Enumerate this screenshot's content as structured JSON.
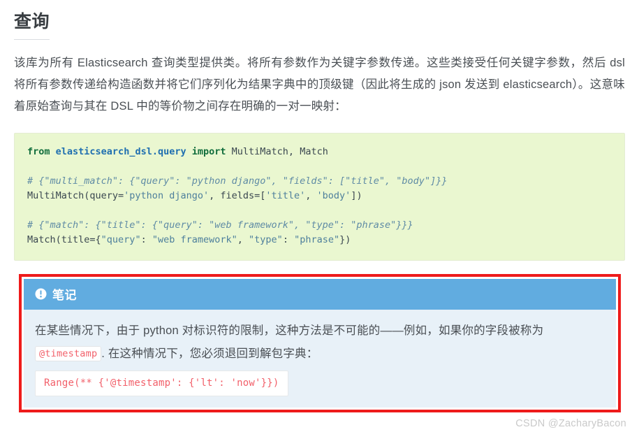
{
  "page": {
    "title": "查询",
    "intro": "该库为所有 Elasticsearch 查询类型提供类。将所有参数作为关键字参数传递。这些类接受任何关键字参数，然后 dsl 将所有参数传递给构造函数并将它们序列化为结果字典中的顶级键（因此将生成的 json 发送到 elasticsearch）。这意味着原始查询与其在 DSL 中的等价物之间存在明确的一对一映射："
  },
  "code_block": {
    "line1_kw_from": "from",
    "line1_module": "elasticsearch_dsl.query",
    "line1_kw_import": "import",
    "line1_names": "MultiMatch, Match",
    "line2_comment": "# {\"multi_match\": {\"query\": \"python django\", \"fields\": [\"title\", \"body\"]}}",
    "line3_call": "MultiMatch(query=",
    "line3_str1": "'python django'",
    "line3_mid": ", fields=[",
    "line3_str2": "'title'",
    "line3_sep": ", ",
    "line3_str3": "'body'",
    "line3_end": "])",
    "line4_comment": "# {\"match\": {\"title\": {\"query\": \"web framework\", \"type\": \"phrase\"}}}",
    "line5_call": "Match(title={",
    "line5_str1": "\"query\"",
    "line5_mid1": ": ",
    "line5_str2": "\"web framework\"",
    "line5_mid2": ", ",
    "line5_str3": "\"type\"",
    "line5_mid3": ": ",
    "line5_str4": "\"phrase\"",
    "line5_end": "})"
  },
  "note": {
    "icon": "exclamation-circle-icon",
    "header_label": "笔记",
    "body_part1": "在某些情况下，由于 python 对标识符的限制，这种方法是不可能的——例如，如果你的字段被称为",
    "inline_code": "@timestamp",
    "body_part2": ". 在这种情况下，您必须退回到解包字典：",
    "code": "Range(** {'@timestamp': {'lt': 'now'}})"
  },
  "watermark": {
    "text": "CSDN @ZacharyBacon"
  },
  "colors": {
    "note_header_blue": "#61ace0",
    "note_body_blue": "#e8f1f8",
    "highlight_red": "#ee1b1b",
    "code_bg_green": "#eaf7d0",
    "inline_code_red": "#f2606a"
  }
}
